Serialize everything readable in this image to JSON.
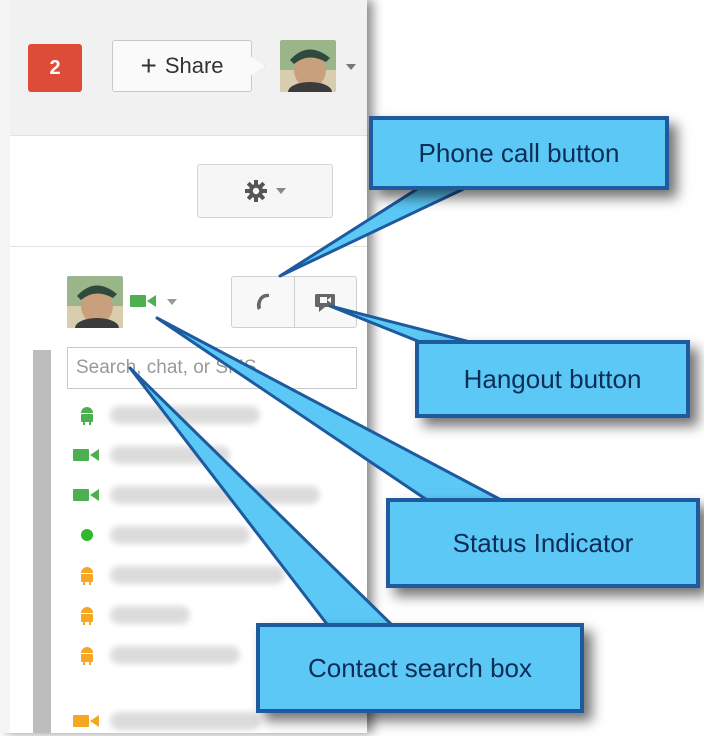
{
  "header": {
    "notification_count": "2",
    "share_label": "Share"
  },
  "search": {
    "placeholder": "Search, chat, or SMS"
  },
  "contacts": [
    {
      "status": "android",
      "status_color": "#a4c639"
    },
    {
      "status": "video",
      "status_color": "#4caf50"
    },
    {
      "status": "video",
      "status_color": "#4caf50"
    },
    {
      "status": "online",
      "status_color": "#2eb82e"
    },
    {
      "status": "android-idle",
      "status_color": "#f5a623"
    },
    {
      "status": "android-idle",
      "status_color": "#f5a623"
    },
    {
      "status": "android-idle",
      "status_color": "#f5a623"
    },
    {
      "status": "video-idle",
      "status_color": "#f5a623"
    }
  ],
  "callouts": {
    "phone_call": "Phone call button",
    "hangout": "Hangout button",
    "status_indicator": "Status Indicator",
    "contact_search": "Contact search box"
  },
  "colors": {
    "callout_fill": "#5bc8f5",
    "callout_border": "#1e5a9e",
    "notification_badge": "#dd4b39"
  }
}
